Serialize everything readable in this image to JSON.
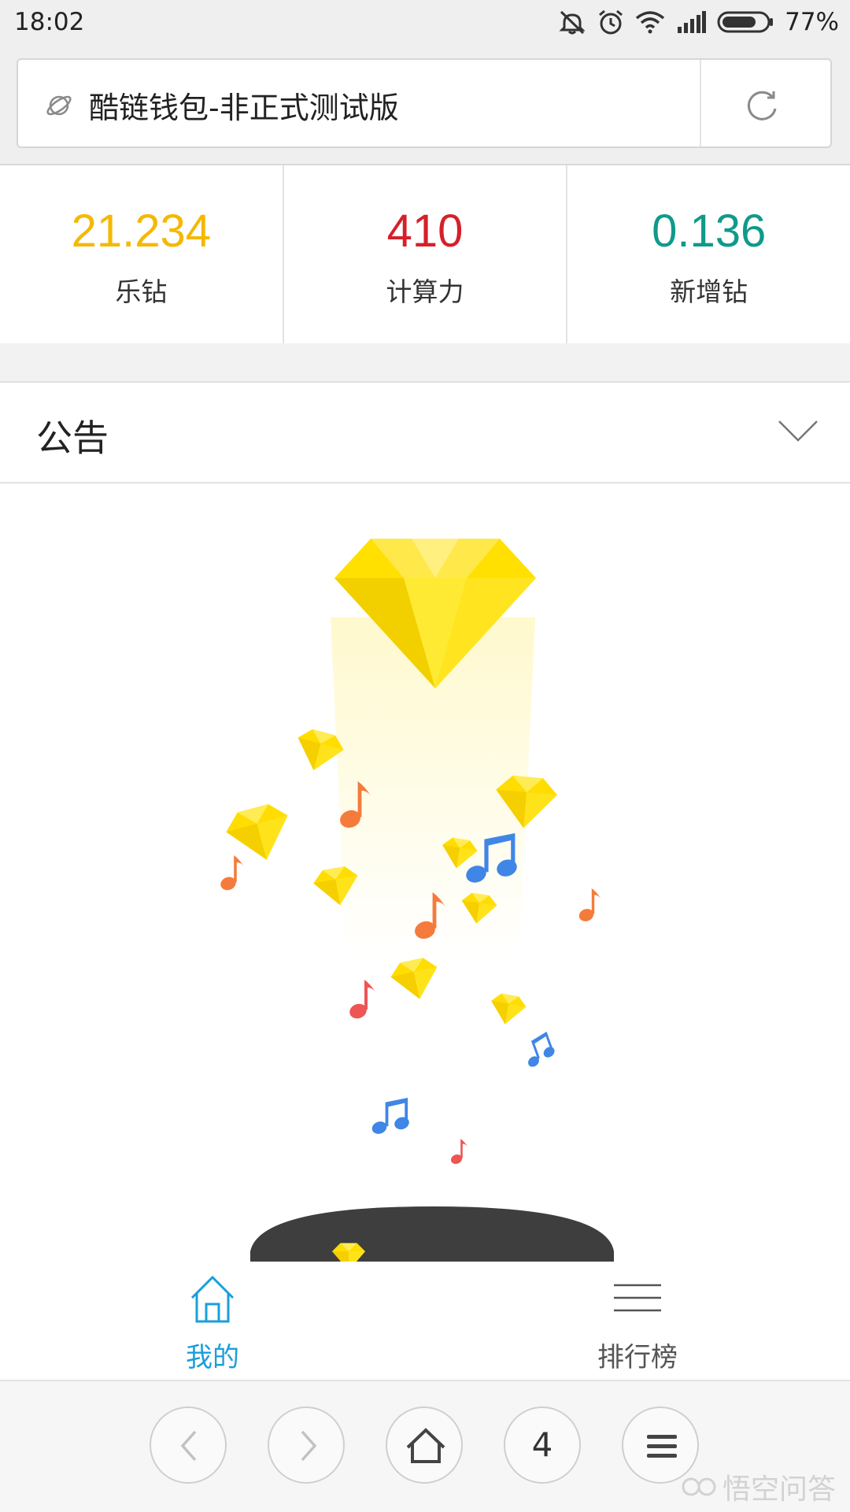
{
  "status_bar": {
    "time": "18:02",
    "battery_percent": "77%",
    "battery_level": 0.77,
    "icons": [
      "mute-icon",
      "alarm-icon",
      "wifi-icon",
      "signal-icon",
      "battery-icon"
    ]
  },
  "browser": {
    "page_title": "酷链钱包-非正式测试版",
    "icons": [
      "planet-icon",
      "refresh-icon"
    ]
  },
  "stats": [
    {
      "value": "21.234",
      "label": "乐钻",
      "color": "#f5b800"
    },
    {
      "value": "410",
      "label": "计算力",
      "color": "#d5202a"
    },
    {
      "value": "0.136",
      "label": "新增钻",
      "color": "#0f9a8a"
    }
  ],
  "notice": {
    "title": "公告",
    "icon": "chevron-down-icon"
  },
  "tabs": [
    {
      "label": "我的",
      "icon": "home-icon",
      "active": true,
      "color": "#1a9fd9"
    },
    {
      "label": "排行榜",
      "icon": "menu-lines-icon",
      "active": false,
      "color": "#555555"
    }
  ],
  "nav": {
    "tab_count": "4",
    "icons": [
      "back-icon",
      "forward-icon",
      "home-icon",
      "menu-icon"
    ]
  },
  "watermark": {
    "text": "悟空问答"
  },
  "colors": {
    "diamond": "#ffd900",
    "note_orange": "#f47b3c",
    "note_blue": "#3f86e6",
    "note_red": "#ee5555"
  }
}
